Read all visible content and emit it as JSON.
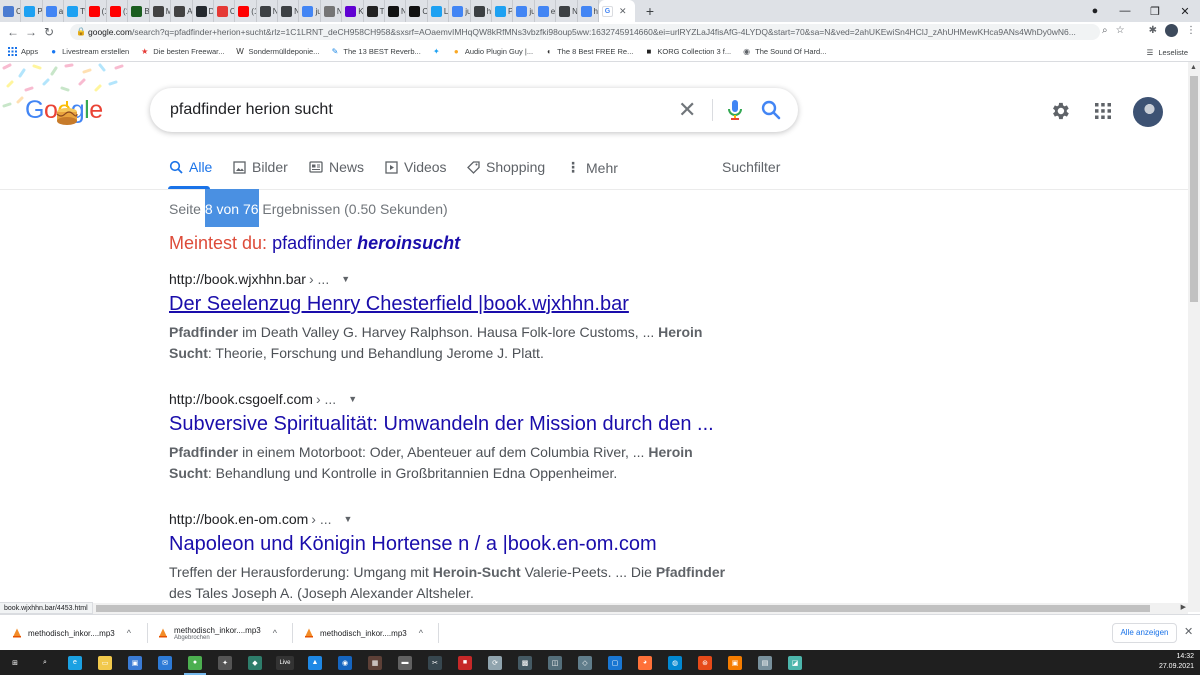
{
  "browser": {
    "tabs": [
      {
        "label": "Ch",
        "icon": "star-icon",
        "color": "#4a7bd1"
      },
      {
        "label": "Pin",
        "icon": "twitter-icon",
        "color": "#1da1f2"
      },
      {
        "label": "am",
        "icon": "google-icon",
        "color": "#4285f4"
      },
      {
        "label": "Tw",
        "icon": "twitter-icon",
        "color": "#1da1f2"
      },
      {
        "label": "(10",
        "icon": "youtube-icon",
        "color": "#ff0000"
      },
      {
        "label": "(10",
        "icon": "youtube-icon",
        "color": "#ff0000"
      },
      {
        "label": "Be",
        "icon": "b-icon",
        "color": "#1b5e20"
      },
      {
        "label": "Ml",
        "icon": "m-icon",
        "color": "#424242"
      },
      {
        "label": "As",
        "icon": "m-icon",
        "color": "#424242"
      },
      {
        "label": "De",
        "icon": "github-icon",
        "color": "#24292e"
      },
      {
        "label": "Cl/",
        "icon": "no-icon",
        "color": "#e53935"
      },
      {
        "label": "(10",
        "icon": "youtube-icon",
        "color": "#ff0000"
      },
      {
        "label": "Ne",
        "icon": "globe-icon",
        "color": "#3c4043"
      },
      {
        "label": "Ne",
        "icon": "globe-icon",
        "color": "#3c4043"
      },
      {
        "label": "juli",
        "icon": "google-icon",
        "color": "#4285f4"
      },
      {
        "label": "Nil",
        "icon": "dash-icon",
        "color": "#757575"
      },
      {
        "label": "Kid",
        "icon": "yahoo-icon",
        "color": "#6001d2"
      },
      {
        "label": "Tru",
        "icon": "s-icon",
        "color": "#222222"
      },
      {
        "label": "Nil",
        "icon": "p-icon",
        "color": "#111111"
      },
      {
        "label": "Cl/",
        "icon": "t-icon",
        "color": "#111111"
      },
      {
        "label": "Lat",
        "icon": "twitter-icon",
        "color": "#1da1f2"
      },
      {
        "label": "juli",
        "icon": "google-icon",
        "color": "#4285f4"
      },
      {
        "label": "htt",
        "icon": "globe-icon",
        "color": "#3c4043"
      },
      {
        "label": "Pin",
        "icon": "twitter-icon",
        "color": "#1da1f2"
      },
      {
        "label": "juli",
        "icon": "google-icon",
        "color": "#4285f4"
      },
      {
        "label": "ein",
        "icon": "google-icon",
        "color": "#4285f4"
      },
      {
        "label": "Ne",
        "icon": "globe-icon",
        "color": "#3c4043"
      },
      {
        "label": "her",
        "icon": "google-icon",
        "color": "#4285f4"
      }
    ],
    "active_tab": {
      "icon": "google-icon",
      "close": "✕"
    },
    "new_tab": "+",
    "url_host": "google.com",
    "url_rest": "/search?q=pfadfinder+herion+sucht&rlz=1C1LRNT_deCH958CH958&sxsrf=AOaemvIMHqQW8kRfMNs3vbzfki98oup5ww:1632745914660&ei=urlRYZLaJ4fisAfG-4LYDQ&start=70&sa=N&ved=2ahUKEwiSn4HClJ_zAhUHMewKHca9ANs4WhDy0wN6..."
  },
  "bookmarks": {
    "apps": "Apps",
    "items": [
      {
        "label": "Livestream erstellen",
        "icon": "facebook-icon"
      },
      {
        "label": "Die besten Freewar...",
        "icon": "star-icon"
      },
      {
        "label": "Sondermülldeponie...",
        "icon": "w-icon"
      },
      {
        "label": "The 13 BEST Reverb...",
        "icon": "pen-icon"
      },
      {
        "label": "",
        "icon": "twitter-icon"
      },
      {
        "label": "Audio Plugin Guy |...",
        "icon": "cookie-icon"
      },
      {
        "label": "The 8 Best FREE Re...",
        "icon": "moon-icon"
      },
      {
        "label": "KORG Collection 3 f...",
        "icon": "korg-icon"
      },
      {
        "label": "The Sound Of Hard...",
        "icon": "globe-icon"
      }
    ],
    "reading_list": "Leseliste"
  },
  "search": {
    "query": "pfadfinder herion sucht",
    "tabs": [
      {
        "label": "Alle",
        "icon": "search-icon",
        "active": true
      },
      {
        "label": "Bilder",
        "icon": "image-icon"
      },
      {
        "label": "News",
        "icon": "news-icon"
      },
      {
        "label": "Videos",
        "icon": "video-icon"
      },
      {
        "label": "Shopping",
        "icon": "tag-icon"
      },
      {
        "label": "Mehr",
        "icon": "more-vert-icon"
      }
    ],
    "filter": "Suchfilter",
    "stats": {
      "prefix": "Seite",
      "highlight": "8 von 76",
      "suffix": "Ergebnissen (0.50 Sekunden)"
    },
    "did_you_mean": {
      "lead": "Meintest du:",
      "plain": "pfadfinder",
      "bold": "heroinsucht"
    }
  },
  "results": [
    {
      "cite": "http://book.wjxhhn.bar",
      "cite_more": "› ...",
      "title": "Der Seelenzug Henry Chesterfield |book.wjxhhn.bar",
      "snippet_parts": [
        {
          "t": "Pfadfinder",
          "b": true
        },
        {
          "t": " im Death Valley G. Harvey Ralphson. Hausa Folk-lore Customs, ... ",
          "b": false
        },
        {
          "t": "Heroin Sucht",
          "b": true
        },
        {
          "t": ": Theorie, Forschung und Behandlung Jerome J. Platt.",
          "b": false
        }
      ]
    },
    {
      "cite": "http://book.csgoelf.com",
      "cite_more": "› ...",
      "title": "Subversive Spiritualität: Umwandeln der Mission durch den ...",
      "snippet_parts": [
        {
          "t": "Pfadfinder",
          "b": true
        },
        {
          "t": " in einem Motorboot: Oder, Abenteuer auf dem Columbia River, ... ",
          "b": false
        },
        {
          "t": "Heroin Sucht",
          "b": true
        },
        {
          "t": ": Behandlung und Kontrolle in Großbritannien Edna Oppenheimer.",
          "b": false
        }
      ]
    },
    {
      "cite": "http://book.en-om.com",
      "cite_more": "› ...",
      "title": "Napoleon und Königin Hortense n / a |book.en-om.com",
      "snippet_parts": [
        {
          "t": "Treffen der Herausforderung: Umgang mit ",
          "b": false
        },
        {
          "t": "Heroin-Sucht",
          "b": true
        },
        {
          "t": " Valerie-Peets. ... Die ",
          "b": false
        },
        {
          "t": "Pfadfinder",
          "b": true
        },
        {
          "t": " des Tales Joseph A. (Joseph Alexander Altsheler.",
          "b": false
        }
      ]
    }
  ],
  "status_url": "book.wjxhhn.bar/4453.html",
  "downloads": [
    {
      "name": "methodisch_inkor....mp3",
      "sub": ""
    },
    {
      "name": "methodisch_inkor....mp3",
      "sub": "Abgebrochen"
    },
    {
      "name": "methodisch_inkor....mp3",
      "sub": ""
    }
  ],
  "show_all": "Alle anzeigen",
  "taskbar": {
    "time": "14:32",
    "date": "27.09.2021",
    "icons": [
      {
        "name": "windows-icon",
        "color": "#ffffff",
        "glyph": "⊞"
      },
      {
        "name": "search-icon",
        "color": "#ffffff",
        "glyph": "⌕"
      },
      {
        "name": "edge-icon",
        "color": "#1ba1e2",
        "glyph": "e"
      },
      {
        "name": "explorer-icon",
        "color": "#f2c94c",
        "glyph": "▭"
      },
      {
        "name": "store-icon",
        "color": "#3a7bd5",
        "glyph": "▣"
      },
      {
        "name": "mail-icon",
        "color": "#2d7ad6",
        "glyph": "✉"
      },
      {
        "name": "chrome-icon",
        "color": "#4caf50",
        "glyph": "●"
      },
      {
        "name": "app-icon",
        "color": "#555555",
        "glyph": "✦"
      },
      {
        "name": "app-icon",
        "color": "#2e7d6b",
        "glyph": "◆"
      },
      {
        "name": "live-icon",
        "color": "#333333",
        "glyph": "Live"
      },
      {
        "name": "app-icon",
        "color": "#1e88e5",
        "glyph": "▲"
      },
      {
        "name": "app-icon",
        "color": "#1565c0",
        "glyph": "◉"
      },
      {
        "name": "app-icon",
        "color": "#5d4037",
        "glyph": "▦"
      },
      {
        "name": "app-icon",
        "color": "#616161",
        "glyph": "▬"
      },
      {
        "name": "app-icon",
        "color": "#37474f",
        "glyph": "✂"
      },
      {
        "name": "app-icon",
        "color": "#c62828",
        "glyph": "■"
      },
      {
        "name": "app-icon",
        "color": "#90a4ae",
        "glyph": "⟳"
      },
      {
        "name": "app-icon",
        "color": "#455a64",
        "glyph": "▩"
      },
      {
        "name": "app-icon",
        "color": "#546e7a",
        "glyph": "◫"
      },
      {
        "name": "app-icon",
        "color": "#607d8b",
        "glyph": "◇"
      },
      {
        "name": "app-icon",
        "color": "#1976d2",
        "glyph": "▢"
      },
      {
        "name": "firefox-icon",
        "color": "#ff7139",
        "glyph": "◕"
      },
      {
        "name": "app-icon",
        "color": "#0288d1",
        "glyph": "◍"
      },
      {
        "name": "app-icon",
        "color": "#e64a19",
        "glyph": "⊛"
      },
      {
        "name": "app-icon",
        "color": "#f57c00",
        "glyph": "▣"
      },
      {
        "name": "app-icon",
        "color": "#78909c",
        "glyph": "▤"
      },
      {
        "name": "app-icon",
        "color": "#4db6ac",
        "glyph": "◪"
      }
    ]
  }
}
